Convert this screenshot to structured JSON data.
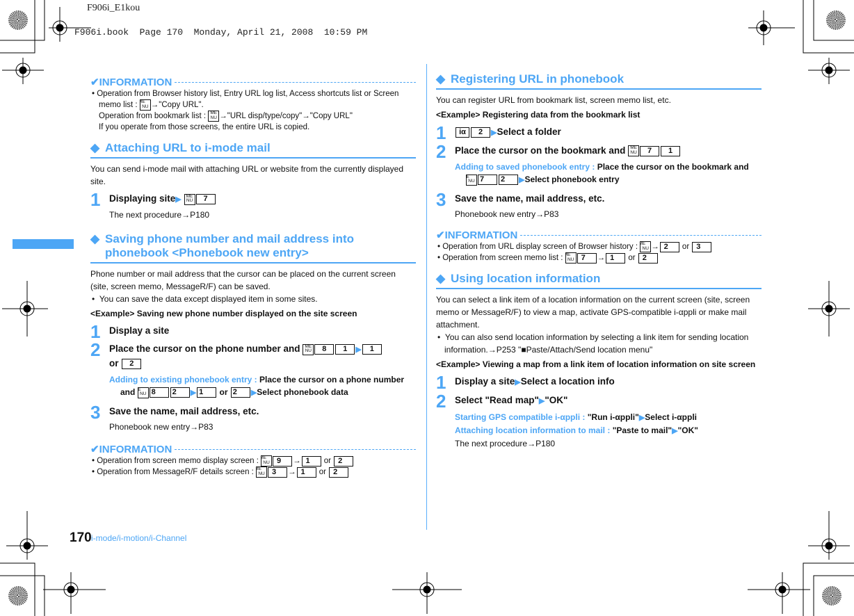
{
  "header": {
    "job_name": "F906i_E1kou",
    "book_line": "F906i.book  Page 170  Monday, April 21, 2008  10:59 PM"
  },
  "colors": {
    "accent": "#4da6f5",
    "text": "#111111"
  },
  "icons": {
    "menu_key": "MENU",
    "i_alpha_key": "iα",
    "arrow": "→",
    "triangle": "▶",
    "check": "✔",
    "diamond": "◆"
  },
  "left": {
    "info1": {
      "title": "INFORMATION",
      "lines": [
        "Operation from Browser history list, Entry URL log list, Access shortcuts list or Screen memo list :",
        "\"Copy URL\".",
        "Operation from bookmark list :",
        "\"URL disp/type/copy\"",
        "\"Copy URL\"",
        "If you operate from those screens, the entire URL is copied."
      ]
    },
    "sec1": {
      "title": "Attaching URL to i-mode mail",
      "body": "You can send i-mode mail with attaching URL or website from the currently displayed site.",
      "step1": {
        "num": "1",
        "text": "Displaying site",
        "key": "7",
        "sub": "The next procedure→P180"
      }
    },
    "sec2": {
      "title_line1": "Saving phone number and mail address into",
      "title_line2": "phonebook <Phonebook new entry>",
      "body": "Phone number or mail address that the cursor can be placed on the current screen (site, screen memo, MessageR/F) can be saved.",
      "bullet": "You can save the data except displayed item in some sites.",
      "example": "<Example> Saving new phone number displayed on the site screen",
      "step1": {
        "num": "1",
        "text": "Display a site"
      },
      "step2": {
        "num": "2",
        "text": "Place the cursor on the phone number and",
        "keys": [
          "8",
          "1",
          "1",
          "2"
        ],
        "or": "or",
        "note_label": "Adding to existing phonebook entry :",
        "note_text": "Place the cursor on a phone number and",
        "note_keys": [
          "8",
          "2",
          "1",
          "2"
        ],
        "note_end": "Select phonebook data"
      },
      "step3": {
        "num": "3",
        "text": "Save the name, mail address, etc.",
        "sub": "Phonebook new entry→P83"
      }
    },
    "info2": {
      "title": "INFORMATION",
      "lines": [
        {
          "text": "Operation from screen memo display screen :",
          "keys": [
            "9",
            "1",
            "2"
          ]
        },
        {
          "text": "Operation from MessageR/F details screen :",
          "keys": [
            "3",
            "1",
            "2"
          ]
        }
      ]
    }
  },
  "right": {
    "sec3": {
      "title": "Registering URL in phonebook",
      "body": "You can register URL from bookmark list, screen memo list, etc.",
      "example": "<Example> Registering data from the bookmark list",
      "step1": {
        "num": "1",
        "key": "2",
        "text": "Select a folder"
      },
      "step2": {
        "num": "2",
        "text": "Place the cursor on the bookmark and",
        "keys": [
          "7",
          "1"
        ],
        "note_label": "Adding to saved phonebook entry :",
        "note_text": "Place the cursor on the bookmark and",
        "note_keys": [
          "7",
          "2"
        ],
        "note_end": "Select phonebook entry"
      },
      "step3": {
        "num": "3",
        "text": "Save the name, mail address, etc.",
        "sub": "Phonebook new entry→P83"
      }
    },
    "info3": {
      "title": "INFORMATION",
      "lines": [
        {
          "text": "Operation from URL display screen of Browser history :",
          "keys": [
            "2",
            "3"
          ]
        },
        {
          "text": "Operation from screen memo list :",
          "keys": [
            "7",
            "1",
            "2"
          ]
        }
      ]
    },
    "sec4": {
      "title": "Using location information",
      "body": "You can select a link item of a location information on the current screen (site, screen memo or MessageR/F) to view a map, activate GPS-compatible i-αppli or make mail attachment.",
      "bullet": "You can also send location information by selecting a link item for sending location information.→P253 \"■Paste/Attach/Send location menu\"",
      "example_label": "<Example>",
      "example": "Viewing a map from a link item of location information on site screen",
      "step1": {
        "num": "1",
        "text_a": "Display a site",
        "text_b": "Select a location info"
      },
      "step2": {
        "num": "2",
        "text_a": "Select \"Read map\"",
        "text_b": "\"OK\"",
        "note1_label": "Starting GPS compatible i-αppli :",
        "note1_a": "\"Run i-αppli\"",
        "note1_b": "Select i-αppli",
        "note2_label": "Attaching location information to mail :",
        "note2_a": "\"Paste to mail\"",
        "note2_b": "\"OK\"",
        "sub": "The next procedure→P180"
      }
    }
  },
  "footer": {
    "page_number": "170",
    "chapter": "i-mode/i-motion/i-Channel"
  }
}
